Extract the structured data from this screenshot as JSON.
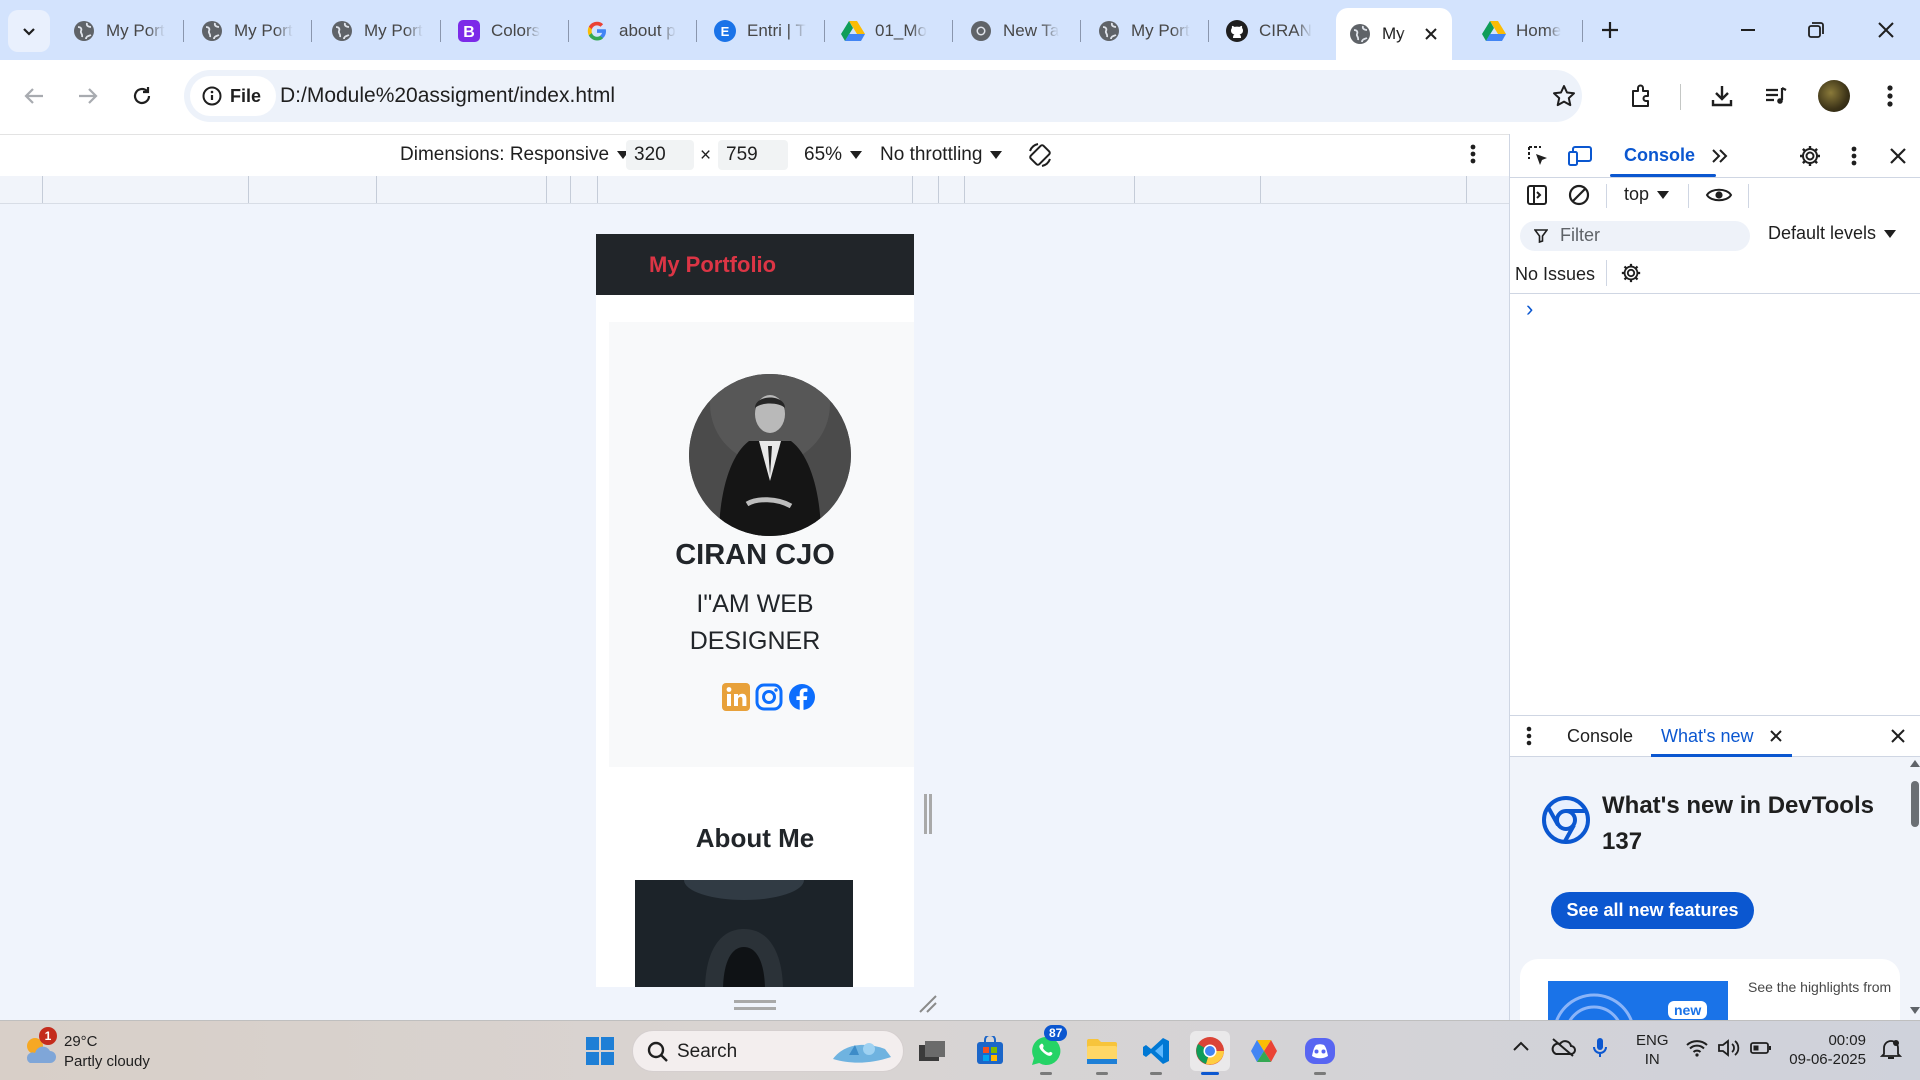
{
  "browser": {
    "tabs": [
      {
        "label": "My Port",
        "icon": "globe-icon"
      },
      {
        "label": "My Port",
        "icon": "globe-icon"
      },
      {
        "label": "My Port",
        "icon": "globe-icon"
      },
      {
        "label": "Colors",
        "icon": "bootstrap-icon"
      },
      {
        "label": "about p",
        "icon": "google-icon"
      },
      {
        "label": "Entri | T",
        "icon": "entri-icon"
      },
      {
        "label": "01_Mo",
        "icon": "drive-icon"
      },
      {
        "label": "New Ta",
        "icon": "chrome-icon"
      },
      {
        "label": "My Port",
        "icon": "globe-icon"
      },
      {
        "label": "CIRAN",
        "icon": "github-icon"
      },
      {
        "label": "My",
        "icon": "globe-icon",
        "active": true
      },
      {
        "label": "Home",
        "icon": "drive-icon"
      }
    ],
    "address": {
      "chip_label": "File",
      "url": "D:/Module%20assigment/index.html"
    }
  },
  "device_toolbar": {
    "dimensions_label": "Dimensions: Responsive",
    "width": "320",
    "times": "×",
    "height": "759",
    "zoom": "65%",
    "throttling": "No throttling"
  },
  "page": {
    "brand": "My Portfolio",
    "brand_color": "#dc3545",
    "name": "CIRAN CJO",
    "title_line1": "I\"AM WEB",
    "title_line2": "DESIGNER",
    "socials": [
      "linkedin-icon",
      "instagram-icon",
      "facebook-icon"
    ],
    "social_color": "#e8a13a",
    "about_heading": "About Me"
  },
  "devtools": {
    "tab_console": "Console",
    "context": "top",
    "filter_placeholder": "Filter",
    "levels": "Default levels",
    "issues": "No Issues",
    "prompt": "›",
    "drawer_tab_console": "Console",
    "drawer_tab_whatsnew": "What's new",
    "whatsnew_title": "What's new in DevTools",
    "whatsnew_version": "137",
    "whatsnew_button": "See all new features",
    "card_badge": "new",
    "card_text": "See the highlights from"
  },
  "taskbar": {
    "weather_temp": "29°C",
    "weather_desc": "Partly cloudy",
    "weather_badge": "1",
    "search_placeholder": "Search",
    "whatsapp_badge": "87",
    "lang_line1": "ENG",
    "lang_line2": "IN",
    "time": "00:09",
    "date": "09-06-2025"
  },
  "colors": {
    "accent": "#0b57d0",
    "tabstrip": "#d3e3fd",
    "navbar": "#212529"
  }
}
